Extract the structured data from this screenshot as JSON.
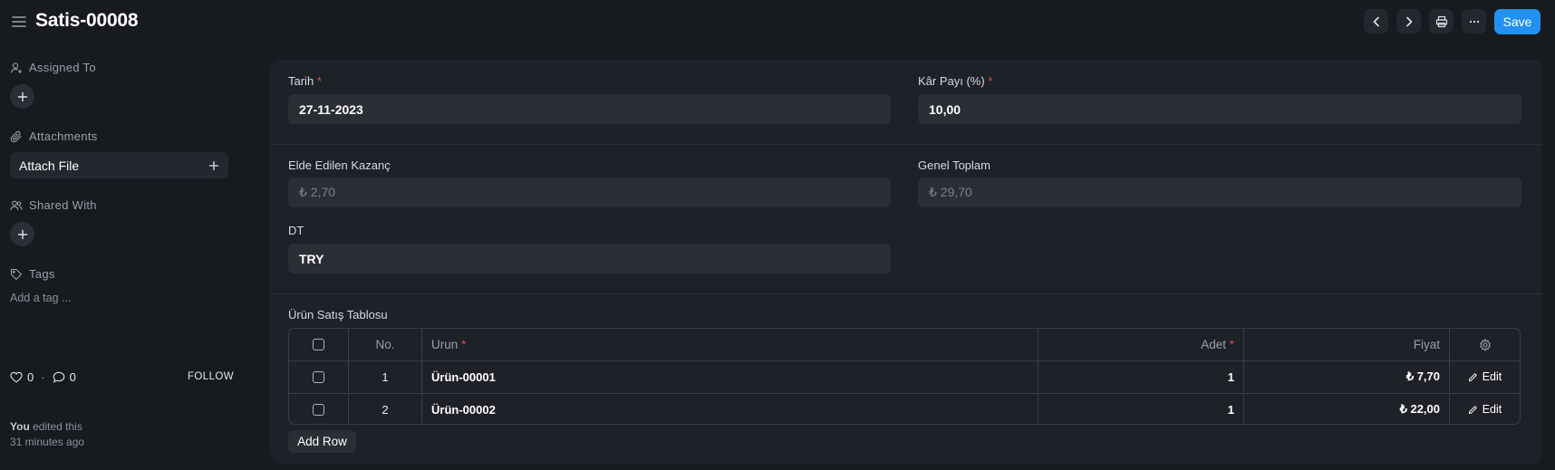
{
  "header": {
    "title": "Satis-00008",
    "save_label": "Save"
  },
  "sidebar": {
    "assigned_to": "Assigned To",
    "attachments": "Attachments",
    "attach_file": "Attach File",
    "shared_with": "Shared With",
    "tags": "Tags",
    "add_tag": "Add a tag ...",
    "likes_count": "0",
    "comments_count": "0",
    "follow": "FOLLOW",
    "activity_user": "You",
    "activity_text": "edited this",
    "activity_time": "31 minutes ago"
  },
  "form": {
    "tarih_label": "Tarih",
    "tarih_value": "27-11-2023",
    "kar_payi_label": "Kâr Payı (%)",
    "kar_payi_value": "10,00",
    "kazanc_label": "Elde Edilen Kazanç",
    "kazanc_value": "₺ 2,70",
    "genel_toplam_label": "Genel Toplam",
    "genel_toplam_value": "₺ 29,70",
    "dt_label": "DT",
    "dt_value": "TRY",
    "required_mark": "*"
  },
  "table": {
    "title": "Ürün Satış Tablosu",
    "columns": {
      "no": "No.",
      "urun": "Urun",
      "adet": "Adet",
      "fiyat": "Fiyat"
    },
    "rows": [
      {
        "no": "1",
        "urun": "Ürün-00001",
        "adet": "1",
        "fiyat": "₺ 7,70",
        "action": "Edit"
      },
      {
        "no": "2",
        "urun": "Ürün-00002",
        "adet": "1",
        "fiyat": "₺ 22,00",
        "action": "Edit"
      }
    ],
    "add_row": "Add Row"
  },
  "colors": {
    "accent": "#2490ef",
    "required": "#e24c4c",
    "background": "#171a1f",
    "panel": "#1e2127"
  }
}
